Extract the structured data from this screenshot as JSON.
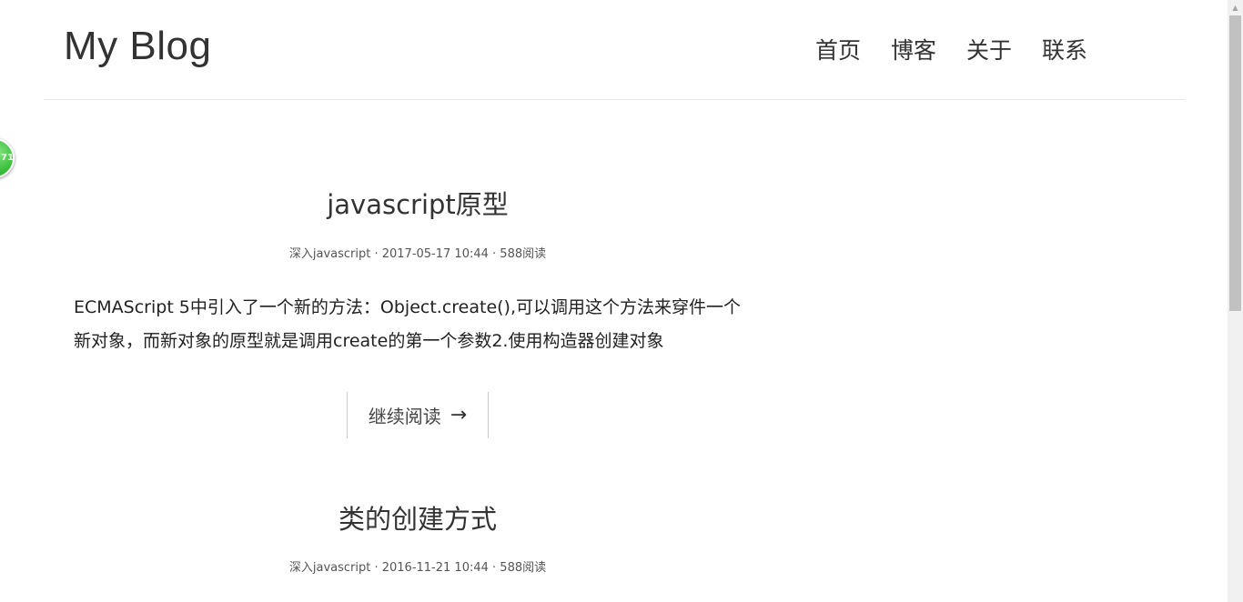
{
  "header": {
    "site_title": "My Blog",
    "nav": [
      {
        "label": "首页"
      },
      {
        "label": "博客"
      },
      {
        "label": "关于"
      },
      {
        "label": "联系"
      }
    ]
  },
  "badge": {
    "text": "71"
  },
  "posts": [
    {
      "title": "javascript原型",
      "category": "深入javascript",
      "date": "2017-05-17 10:44",
      "reads": "588阅读",
      "excerpt": "ECMAScript 5中引入了一个新的方法：Object.create(),可以调用这个方法来穿件一个新对象，而新对象的原型就是调用create的第一个参数2.使用构造器创建对象",
      "read_more": "继续阅读",
      "read_more_icon": "→"
    },
    {
      "title": "类的创建方式",
      "category": "深入javascript",
      "date": "2016-11-21 10:44",
      "reads": "588阅读"
    }
  ],
  "meta_separator": " · "
}
